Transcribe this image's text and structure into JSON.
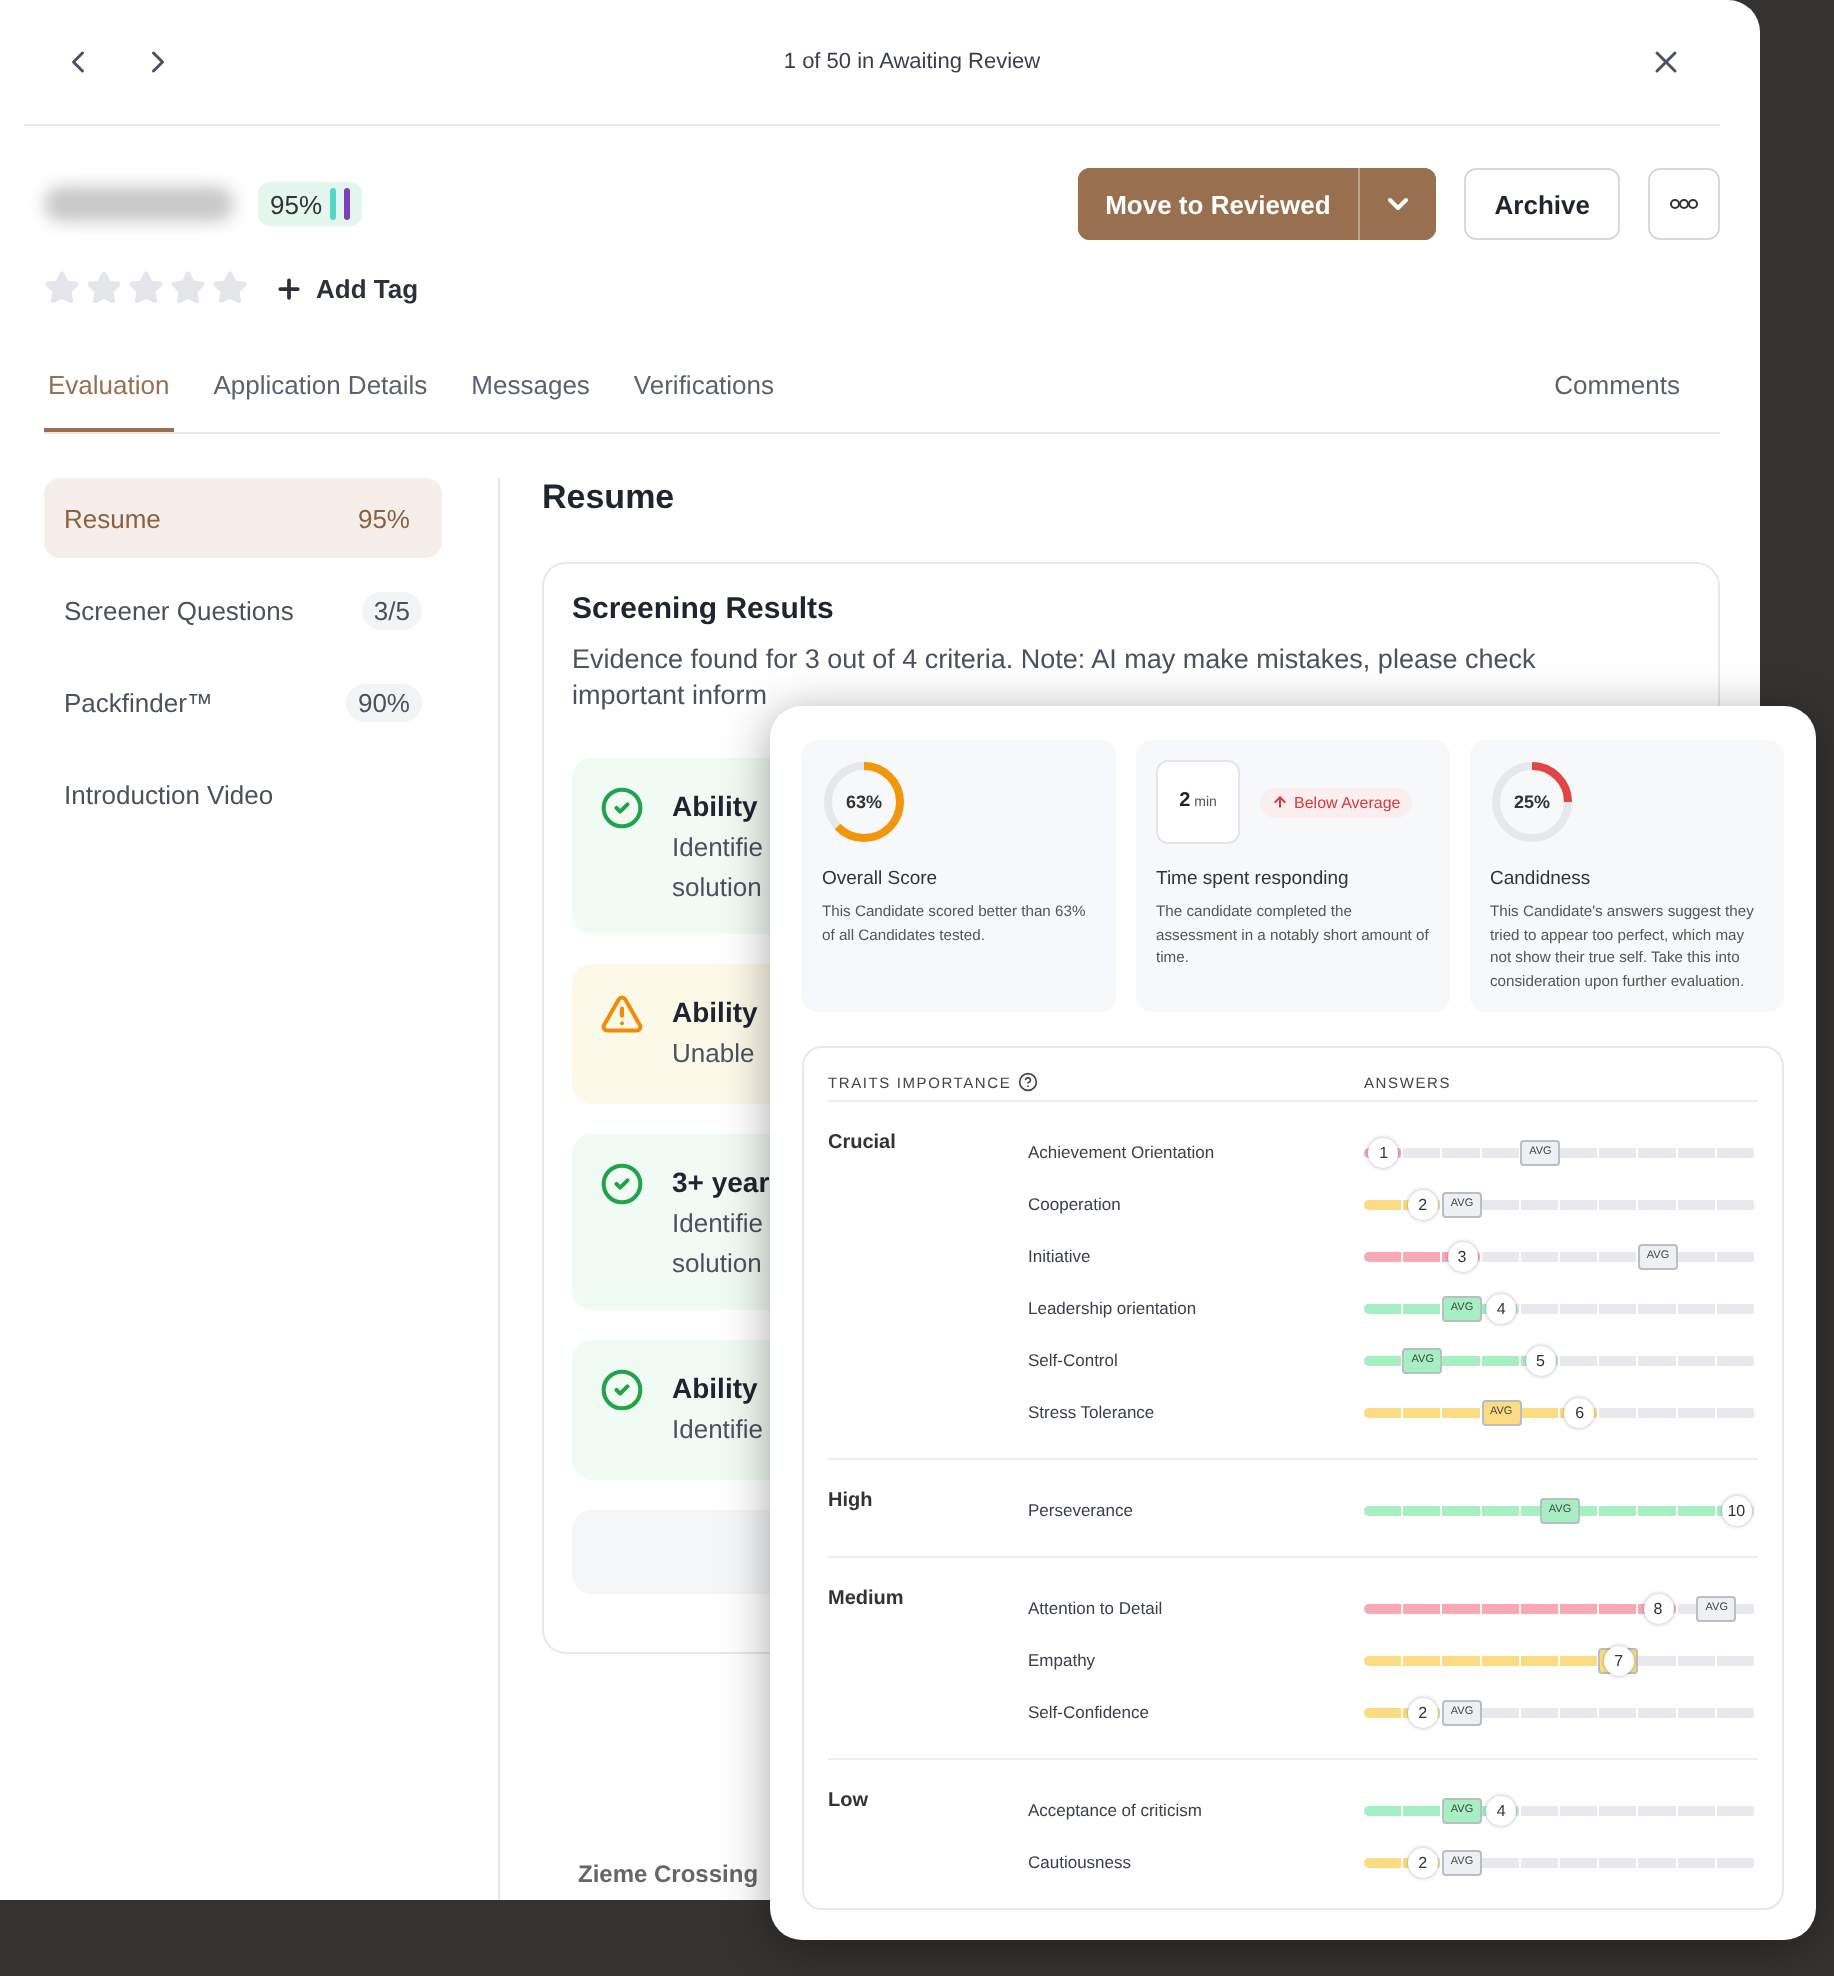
{
  "nav": {
    "counter": "1 of 50 in Awaiting Review"
  },
  "candidate": {
    "match": "95%",
    "stars": 0,
    "add_tag": "Add Tag"
  },
  "actions": {
    "primary": "Move to Reviewed",
    "archive": "Archive"
  },
  "tabs": [
    {
      "label": "Evaluation",
      "selected": true,
      "kind": "main"
    },
    {
      "label": "Application Details",
      "selected": false,
      "kind": "main"
    },
    {
      "label": "Messages",
      "selected": false,
      "kind": "main"
    },
    {
      "label": "Verifications",
      "selected": false,
      "kind": "main"
    },
    {
      "label": "Comments",
      "selected": false,
      "kind": "side"
    }
  ],
  "sidebar": {
    "items": [
      {
        "label": "Resume",
        "count": "95%",
        "selected": true
      },
      {
        "label": "Screener Questions",
        "count": "3/5",
        "selected": false
      },
      {
        "label": "Packfinder™",
        "count": "90%",
        "selected": false
      },
      {
        "label": "Introduction Video",
        "selected": false
      }
    ]
  },
  "section": {
    "title": "Resume"
  },
  "screening": {
    "title": "Screening Results",
    "summary": "Evidence found for 3 out of 4 criteria. Note: AI may make mistakes, please check important inform",
    "criteria": [
      {
        "kind": "met",
        "title": "Ability",
        "detail": [
          "Identifie",
          "solution"
        ]
      },
      {
        "kind": "warning",
        "title": "Ability",
        "detail": [
          "Unable"
        ]
      },
      {
        "kind": "met",
        "title": "3+ year",
        "detail": [
          "Identifie",
          "solution"
        ]
      },
      {
        "kind": "met",
        "title": "Ability",
        "detail": [
          "Identifie"
        ]
      },
      {
        "kind": "empty"
      }
    ]
  },
  "footer_text": "Zieme Crossing",
  "assessment": {
    "stats": [
      {
        "kind": "donut",
        "value": "63%",
        "level": 0.63,
        "color": "#f2960c",
        "title": "Overall Score",
        "description": "This Candidate scored better than 63% of all Candidates tested."
      },
      {
        "kind": "time",
        "value": "2",
        "unit": "min",
        "badge": "Below Average",
        "title": "Time spent responding",
        "description": "The candidate completed the assessment in a notably short amount of time."
      },
      {
        "kind": "donut",
        "value": "25%",
        "level": 0.25,
        "color": "#e04646",
        "title": "Candidness",
        "description": "This Candidate's answers suggest they tried to appear too perfect, which may not show their true self. Take this into consideration upon further evaluation."
      }
    ],
    "traits": {
      "heading": "TRAITS IMPORTANCE",
      "answers_heading": "ANSWERS",
      "groups": [
        {
          "name": "Crucial",
          "traits": [
            {
              "name": "Achievement Orientation",
              "score": "1",
              "level": 0.05,
              "color": "#f9a8b4",
              "avg": {
                "label": "AVG",
                "level": 0.45
              }
            },
            {
              "name": "Cooperation",
              "score": "2",
              "level": 0.15,
              "color": "#fcdc82",
              "avg": {
                "label": "AVG",
                "level": 0.25
              }
            },
            {
              "name": "Initiative",
              "score": "3",
              "level": 0.25,
              "color": "#f9a8b4",
              "avg": {
                "label": "AVG",
                "level": 0.75
              }
            },
            {
              "name": "Leadership orientation",
              "score": "4",
              "level": 0.35,
              "color": "#a6efc3",
              "avg": {
                "label": "AVG",
                "level": 0.25
              }
            },
            {
              "name": "Self-Control",
              "score": "5",
              "level": 0.45,
              "color": "#a6efc3",
              "avg": {
                "label": "AVG",
                "level": 0.15
              }
            },
            {
              "name": "Stress Tolerance",
              "score": "6",
              "level": 0.55,
              "color": "#fcdc82",
              "avg": {
                "label": "AVG",
                "level": 0.35
              }
            }
          ]
        },
        {
          "name": "High",
          "traits": [
            {
              "name": "Perseverance",
              "score": "10",
              "level": 0.95,
              "color": "#a6efc3",
              "avg": {
                "label": "AVG",
                "level": 0.5
              }
            }
          ]
        },
        {
          "name": "Medium",
          "traits": [
            {
              "name": "Attention to Detail",
              "score": "8",
              "level": 0.75,
              "color": "#f9a8b4",
              "avg": {
                "label": "AVG",
                "level": 0.9
              }
            },
            {
              "name": "Empathy",
              "score": "7",
              "level": 0.65,
              "color": "#fcdc82",
              "avg": {
                "level": 0.65
              }
            },
            {
              "name": "Self-Confidence",
              "score": "2",
              "level": 0.15,
              "color": "#fcdc82",
              "avg": {
                "label": "AVG",
                "level": 0.25
              }
            }
          ]
        },
        {
          "name": "Low",
          "traits": [
            {
              "name": "Acceptance of criticism",
              "score": "4",
              "level": 0.35,
              "color": "#a6efc3",
              "avg": {
                "label": "AVG",
                "level": 0.25
              }
            },
            {
              "name": "Cautiousness",
              "score": "2",
              "level": 0.15,
              "color": "#fcdc82",
              "avg": {
                "label": "AVG",
                "level": 0.25
              }
            }
          ]
        }
      ]
    }
  }
}
